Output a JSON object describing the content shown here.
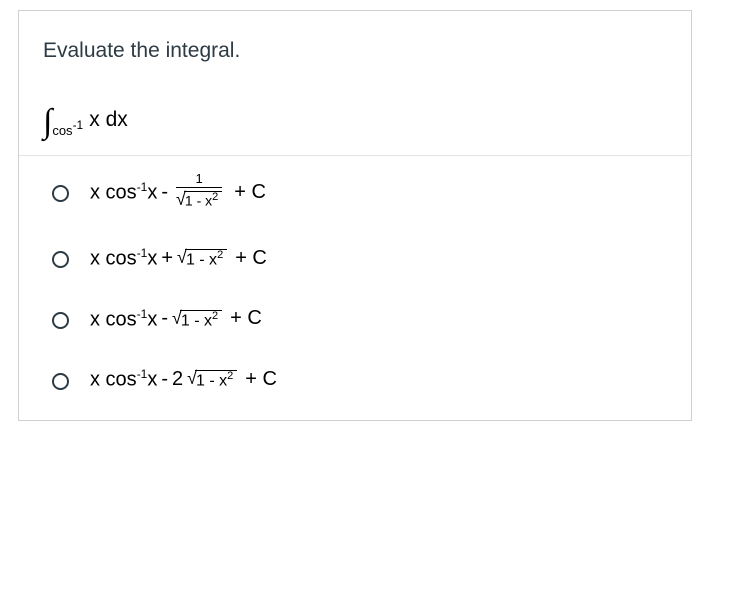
{
  "question": {
    "prompt": "Evaluate the integral.",
    "integral": {
      "symbol": "∫",
      "subscript_cos": "cos",
      "subscript_exp": "-1",
      "rest": " x dx"
    }
  },
  "options": [
    {
      "prefix": "x cos",
      "exp": "-1",
      "after_prefix": "x",
      "op": " - ",
      "has_fraction": true,
      "fraction_num": "1",
      "sqrt_radicand_base": "1 - x",
      "sqrt_exp": "2",
      "coef_before_sqrt": "",
      "tail": " + C"
    },
    {
      "prefix": "x cos",
      "exp": "-1",
      "after_prefix": "x",
      "op": " + ",
      "has_fraction": false,
      "sqrt_radicand_base": "1 - x",
      "sqrt_exp": "2",
      "coef_before_sqrt": "",
      "tail": " + C"
    },
    {
      "prefix": "x cos",
      "exp": "-1",
      "after_prefix": "x",
      "op": " - ",
      "has_fraction": false,
      "sqrt_radicand_base": "1 - x",
      "sqrt_exp": "2",
      "coef_before_sqrt": "",
      "tail": " + C"
    },
    {
      "prefix": "x cos",
      "exp": "-1",
      "after_prefix": "x",
      "op": " - ",
      "has_fraction": false,
      "sqrt_radicand_base": "1 - x",
      "sqrt_exp": "2",
      "coef_before_sqrt": "2",
      "tail": " + C"
    }
  ]
}
